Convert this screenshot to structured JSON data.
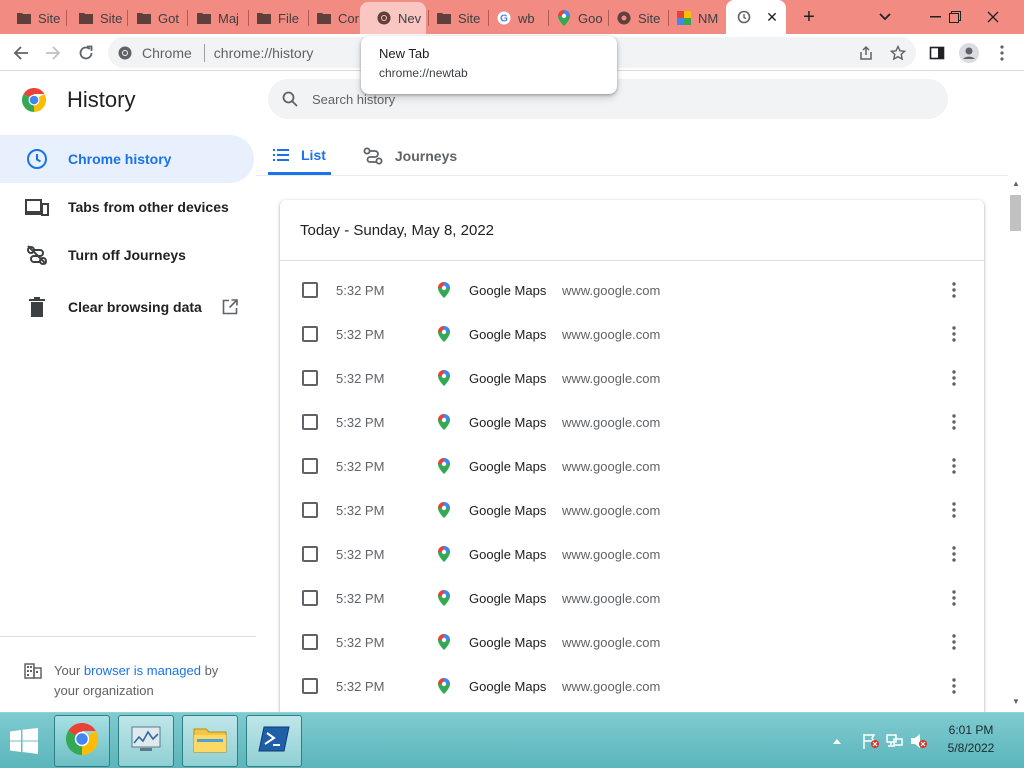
{
  "browser": {
    "tabs": [
      {
        "label": "Site",
        "icon": "folder-icon"
      },
      {
        "label": "Site",
        "icon": "folder-icon"
      },
      {
        "label": "Got",
        "icon": "folder-icon"
      },
      {
        "label": "Maj",
        "icon": "folder-icon"
      },
      {
        "label": "File",
        "icon": "folder-icon"
      },
      {
        "label": "Cor",
        "icon": "folder-icon"
      },
      {
        "label": "Nev",
        "icon": "chrome-icon"
      },
      {
        "label": "Site",
        "icon": "folder-icon"
      },
      {
        "label": "wb",
        "icon": "google-icon"
      },
      {
        "label": "Goo",
        "icon": "maps-pin-icon"
      },
      {
        "label": "Site",
        "icon": "globe-icon"
      },
      {
        "label": "NM",
        "icon": "pinwheel-icon"
      }
    ],
    "active_tab_icon": "history-icon",
    "omnibox": {
      "site_label": "Chrome",
      "url": "chrome://history"
    },
    "tooltip": {
      "title": "New Tab",
      "url": "chrome://newtab"
    }
  },
  "history_page": {
    "title": "History",
    "search_placeholder": "Search history",
    "sidebar": {
      "items": [
        {
          "label": "Chrome history",
          "icon": "clock-icon",
          "selected": true
        },
        {
          "label": "Tabs from other devices",
          "icon": "devices-icon"
        },
        {
          "label": "Turn off Journeys",
          "icon": "journeys-off-icon"
        },
        {
          "label": "Clear browsing data",
          "icon": "trash-icon"
        }
      ],
      "managed": {
        "prefix": "Your ",
        "link": "browser is managed",
        "suffix": " by your organization"
      }
    },
    "tabs": [
      {
        "label": "List",
        "icon": "list-icon",
        "active": true
      },
      {
        "label": "Journeys",
        "icon": "journeys-icon",
        "active": false
      }
    ],
    "day_header": "Today - Sunday, May 8, 2022",
    "entries": [
      {
        "time": "5:32 PM",
        "title": "Google Maps",
        "domain": "www.google.com"
      },
      {
        "time": "5:32 PM",
        "title": "Google Maps",
        "domain": "www.google.com"
      },
      {
        "time": "5:32 PM",
        "title": "Google Maps",
        "domain": "www.google.com"
      },
      {
        "time": "5:32 PM",
        "title": "Google Maps",
        "domain": "www.google.com"
      },
      {
        "time": "5:32 PM",
        "title": "Google Maps",
        "domain": "www.google.com"
      },
      {
        "time": "5:32 PM",
        "title": "Google Maps",
        "domain": "www.google.com"
      },
      {
        "time": "5:32 PM",
        "title": "Google Maps",
        "domain": "www.google.com"
      },
      {
        "time": "5:32 PM",
        "title": "Google Maps",
        "domain": "www.google.com"
      },
      {
        "time": "5:32 PM",
        "title": "Google Maps",
        "domain": "www.google.com"
      },
      {
        "time": "5:32 PM",
        "title": "Google Maps",
        "domain": "www.google.com"
      }
    ]
  },
  "taskbar": {
    "clock_time": "6:01 PM",
    "clock_date": "5/8/2022",
    "apps": [
      "chrome-icon",
      "task-manager-icon",
      "file-explorer-icon",
      "powershell-icon"
    ]
  },
  "colors": {
    "tabstrip": "#f28b82",
    "accent": "#1a73e8",
    "taskbar": "#6cbfc4"
  }
}
